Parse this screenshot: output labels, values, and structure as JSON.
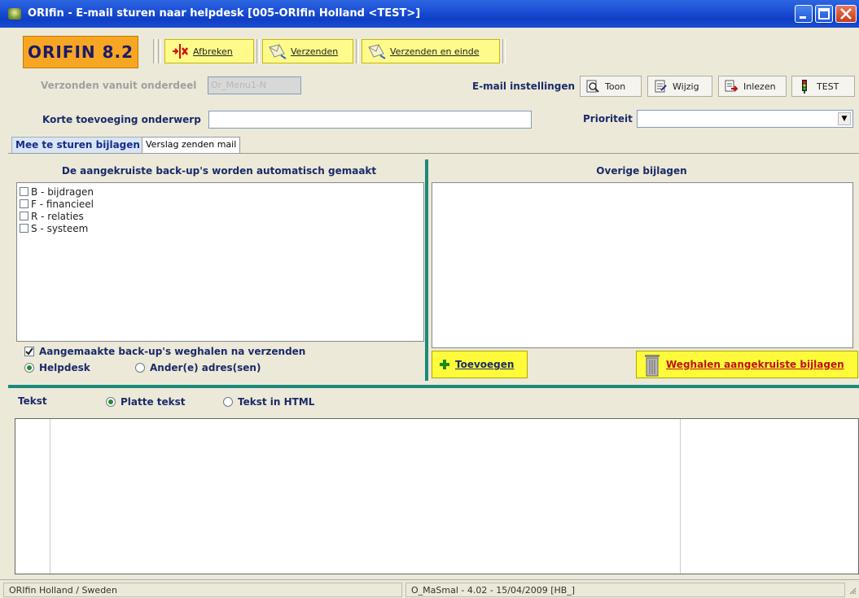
{
  "window": {
    "title": "ORIfin - E-mail sturen naar helpdesk [005-ORIfin Holland <TEST>]"
  },
  "toolbar": {
    "logo": "ORIFIN 8.2",
    "abort_label": "Afbreken",
    "send_label": "Verzenden",
    "send_end_label": "Verzenden en einde"
  },
  "form": {
    "send_from_label": "Verzonden vanuit onderdeel",
    "send_from_value": "Or_Menu1-N",
    "email_settings_label": "E-mail instellingen",
    "show_label": "Toon",
    "edit_label": "Wijzig",
    "import_label": "Inlezen",
    "test_label": "TEST",
    "subject_label": "Korte toevoeging onderwerp",
    "subject_value": "",
    "priority_label": "Prioriteit",
    "priority_value": ""
  },
  "tabs": [
    {
      "label": "Mee te sturen bijlagen"
    },
    {
      "label": "Verslag zenden mail"
    }
  ],
  "backups": {
    "header": "De aangekruiste back-up's worden automatisch gemaakt",
    "items": [
      {
        "label": "B - bijdragen"
      },
      {
        "label": "F - financieel"
      },
      {
        "label": "R - relaties"
      },
      {
        "label": "S - systeem"
      }
    ],
    "remove_after_label": "Aangemaakte back-up's weghalen na verzenden",
    "helpdesk_label": "Helpdesk",
    "other_address_label": "Ander(e) adres(sen)"
  },
  "attachments": {
    "header": "Overige bijlagen",
    "add_label": "Toevoegen",
    "remove_label": "Weghalen aangekruiste bijlagen"
  },
  "text": {
    "label": "Tekst",
    "plain_label": "Platte tekst",
    "html_label": "Tekst in HTML"
  },
  "status": {
    "left": "ORIfin Holland / Sweden",
    "middle": "O_MaSmal - 4.02 - 15/04/2009 [HB_]"
  },
  "colors": {
    "titlebar": "#1b4fd6",
    "logo_bg": "#f7a623",
    "yellow_button": "#fffb3a",
    "panel_divider": "#1a8a7a"
  }
}
